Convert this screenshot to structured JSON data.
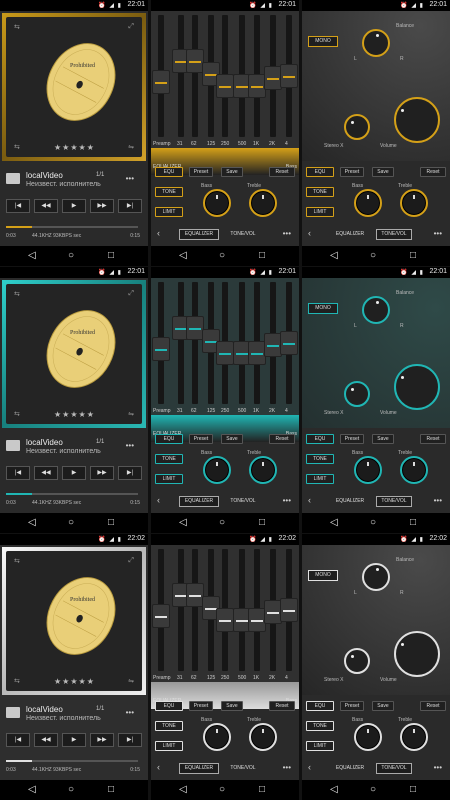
{
  "status_bar": {
    "icons": "⏰ ◢ ▮",
    "times": [
      "22:01",
      "22:01",
      "22:01",
      "22:01",
      "22:01",
      "22:01",
      "22:02",
      "22:02",
      "22:02"
    ]
  },
  "nav": {
    "back": "◁",
    "home": "○",
    "recent": "□"
  },
  "themes": [
    {
      "name": "gold",
      "accent": "#d4a018"
    },
    {
      "name": "teal",
      "accent": "#20b6b4"
    },
    {
      "name": "silver",
      "accent": "#e0e0e0"
    }
  ],
  "player": {
    "track_title": "localVideo",
    "track_artist": "Неизвест. исполнитель",
    "track_count": "1/1",
    "more": "•••",
    "stars": "★★★★★",
    "record_label": "Prohibited",
    "progress_elapsed": "0:03",
    "progress_info": "44.1KHZ 93KBPS sec",
    "progress_total": "0:15",
    "progress_fraction": 0.2,
    "controls": [
      {
        "name": "first",
        "symbol": "|◀"
      },
      {
        "name": "rewind",
        "symbol": "◀◀"
      },
      {
        "name": "play",
        "symbol": "▶"
      },
      {
        "name": "forward",
        "symbol": "▶▶"
      },
      {
        "name": "last",
        "symbol": "▶|"
      }
    ],
    "corner_icon_left": "⇆",
    "corner_icon_right": "⤢",
    "corner_bottom_left": "⇆",
    "corner_bottom_right": "⇋"
  },
  "equalizer": {
    "bands": [
      "Preamp",
      "31",
      "62",
      "125",
      "250",
      "500",
      "1K",
      "2K",
      "4"
    ],
    "levels": [
      0.55,
      0.38,
      0.38,
      0.48,
      0.58,
      0.58,
      0.58,
      0.52,
      0.5
    ],
    "bass_label": "Bass",
    "treble_label": "Treble",
    "equ_button": "EQU",
    "preset_button": "Preset",
    "save_button": "Save",
    "reset_button": "Reset",
    "tone_button": "TONE",
    "limit_button": "LIMIT",
    "tab_equalizer": "EQUALIZER",
    "tab_tonevol": "TONE/VOL",
    "back": "‹",
    "more": "•••",
    "preset_caption": "EQUALIZER",
    "bass_caption": "Bass"
  },
  "tone": {
    "mono": "MONO",
    "balance": "Balance",
    "l": "L",
    "r": "R",
    "stereo_x": "Stereo X",
    "volume": "Volume"
  }
}
